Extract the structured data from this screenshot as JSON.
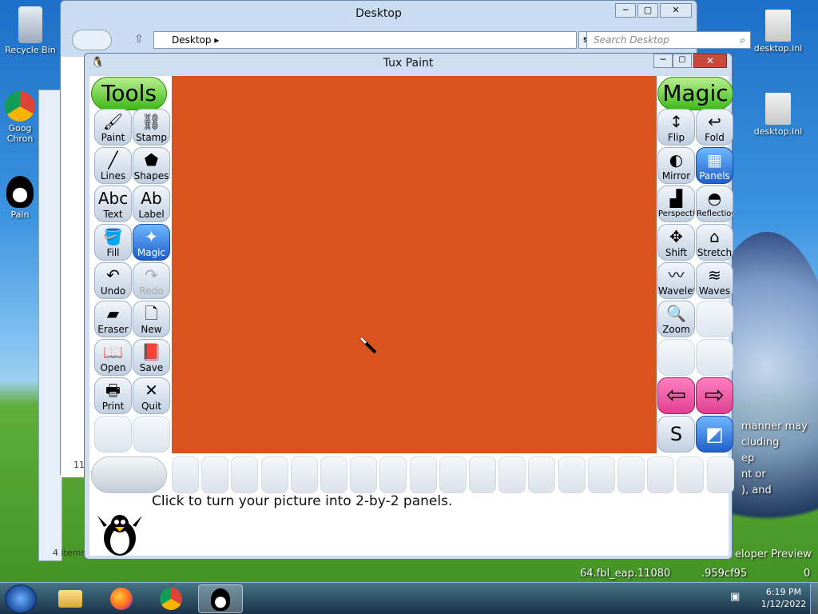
{
  "desktop": {
    "icons": [
      {
        "label": "Recycle Bin"
      },
      {
        "label": "Goog Chron"
      },
      {
        "label": "Pain"
      },
      {
        "label": "desktop.ini"
      },
      {
        "label": "desktop.ini"
      }
    ],
    "bg_text": [
      "manner may",
      "cluding",
      "ep",
      "nt or",
      "), and",
      "eloper Preview",
      "64.fbl_eap.11080",
      ".959cf95",
      "0"
    ]
  },
  "explorer": {
    "title": "Desktop",
    "address": "Desktop",
    "search_placeholder": "Search Desktop",
    "status": "4 items",
    "status_num": "11"
  },
  "tuxpaint": {
    "title": "Tux Paint",
    "tools_header": "Tools",
    "magic_header": "Magic",
    "tools": [
      {
        "label": "Paint",
        "icon": "paintbrush-icon",
        "glyph": "🖌"
      },
      {
        "label": "Stamp",
        "icon": "stamp-icon",
        "glyph": "⛓"
      },
      {
        "label": "Lines",
        "icon": "lines-icon",
        "glyph": "╱"
      },
      {
        "label": "Shapes",
        "icon": "pentagon-icon",
        "glyph": "⬟"
      },
      {
        "label": "Text",
        "icon": "text-icon",
        "glyph": "Abc"
      },
      {
        "label": "Label",
        "icon": "label-icon",
        "glyph": "Ab"
      },
      {
        "label": "Fill",
        "icon": "bucket-icon",
        "glyph": "🪣"
      },
      {
        "label": "Magic",
        "icon": "magic-wand-icon",
        "glyph": "✦"
      },
      {
        "label": "Undo",
        "icon": "undo-icon",
        "glyph": "↶"
      },
      {
        "label": "Redo",
        "icon": "redo-icon",
        "glyph": "↷"
      },
      {
        "label": "Eraser",
        "icon": "eraser-icon",
        "glyph": "▰"
      },
      {
        "label": "New",
        "icon": "new-page-icon",
        "glyph": "🗋"
      },
      {
        "label": "Open",
        "icon": "open-book-icon",
        "glyph": "📖"
      },
      {
        "label": "Save",
        "icon": "save-book-icon",
        "glyph": "📕"
      },
      {
        "label": "Print",
        "icon": "printer-icon",
        "glyph": "🖶"
      },
      {
        "label": "Quit",
        "icon": "quit-icon",
        "glyph": "✕"
      }
    ],
    "magic_tools": [
      {
        "label": "Flip",
        "icon": "flip-icon",
        "glyph": "↕"
      },
      {
        "label": "Fold",
        "icon": "fold-icon",
        "glyph": "↩"
      },
      {
        "label": "Mirror",
        "icon": "mirror-icon",
        "glyph": "◐"
      },
      {
        "label": "Panels",
        "icon": "panels-icon",
        "glyph": "▦"
      },
      {
        "label": "Perspective",
        "icon": "perspective-icon",
        "glyph": "▟"
      },
      {
        "label": "Reflection",
        "icon": "reflection-icon",
        "glyph": "◓"
      },
      {
        "label": "Shift",
        "icon": "shift-arrows-icon",
        "glyph": "✥"
      },
      {
        "label": "Stretch",
        "icon": "stretch-icon",
        "glyph": "⌂"
      },
      {
        "label": "Wavelets",
        "icon": "wavelets-icon",
        "glyph": "〰"
      },
      {
        "label": "Waves",
        "icon": "waves-icon",
        "glyph": "≋"
      },
      {
        "label": "Zoom",
        "icon": "zoom-icon",
        "glyph": "🔍"
      }
    ],
    "nav_prev_glyph": "⇦",
    "nav_next_glyph": "⇨",
    "mode_paint_glyph": "S",
    "mode_full_glyph": "◩",
    "canvas_color": "#d9531e",
    "message": "Click to turn your picture into 2-by-2 panels."
  },
  "taskbar": {
    "time": "6:19 PM",
    "date": "1/12/2022"
  }
}
